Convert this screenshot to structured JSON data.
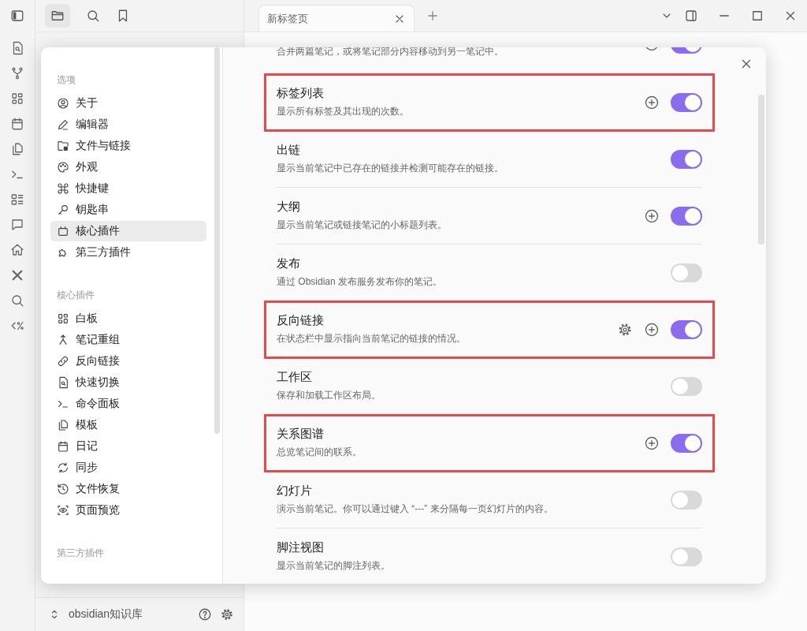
{
  "tab": {
    "title": "新标签页"
  },
  "settings": {
    "sidebar_sections": [
      {
        "header": "选项",
        "items": [
          {
            "label": "关于",
            "selected": false
          },
          {
            "label": "编辑器",
            "selected": false
          },
          {
            "label": "文件与链接",
            "selected": false
          },
          {
            "label": "外观",
            "selected": false
          },
          {
            "label": "快捷键",
            "selected": false
          },
          {
            "label": "钥匙串",
            "selected": false
          },
          {
            "label": "核心插件",
            "selected": true
          },
          {
            "label": "第三方插件",
            "selected": false
          }
        ]
      },
      {
        "header": "核心插件",
        "items": [
          {
            "label": "白板",
            "selected": false
          },
          {
            "label": "笔记重组",
            "selected": false
          },
          {
            "label": "反向链接",
            "selected": false
          },
          {
            "label": "快速切换",
            "selected": false
          },
          {
            "label": "命令面板",
            "selected": false
          },
          {
            "label": "模板",
            "selected": false
          },
          {
            "label": "日记",
            "selected": false
          },
          {
            "label": "同步",
            "selected": false
          },
          {
            "label": "文件恢复",
            "selected": false
          },
          {
            "label": "页面预览",
            "selected": false
          }
        ]
      },
      {
        "header": "第三方插件"
      }
    ],
    "plugins": [
      {
        "description": "合并两篇笔记，或将笔记部分内容移动到另一笔记中。",
        "on": true,
        "settings_button": false,
        "add_button": true,
        "highlighted": false
      },
      {
        "title": "标签列表",
        "description": "显示所有标签及其出现的次数。",
        "on": true,
        "settings_button": false,
        "add_button": true,
        "highlighted": true
      },
      {
        "title": "出链",
        "description": "显示当前笔记中已存在的链接并检测可能存在的链接。",
        "on": true,
        "settings_button": false,
        "add_button": false,
        "highlighted": false
      },
      {
        "title": "大纲",
        "description": "显示当前笔记或链接笔记的小标题列表。",
        "on": true,
        "settings_button": false,
        "add_button": true,
        "highlighted": false
      },
      {
        "title": "发布",
        "description": "通过 Obsidian 发布服务发布你的笔记。",
        "on": false,
        "settings_button": false,
        "add_button": false,
        "highlighted": false
      },
      {
        "title": "反向链接",
        "description": "在状态栏中显示指向当前笔记的链接的情况。",
        "on": true,
        "settings_button": true,
        "add_button": true,
        "highlighted": true
      },
      {
        "title": "工作区",
        "description": "保存和加载工作区布局。",
        "on": false,
        "settings_button": false,
        "add_button": false,
        "highlighted": false
      },
      {
        "title": "关系图谱",
        "description": "总览笔记间的联系。",
        "on": true,
        "settings_button": false,
        "add_button": true,
        "highlighted": true
      },
      {
        "title": "幻灯片",
        "description": "演示当前笔记。你可以通过键入 “---” 来分隔每一页幻灯片的内容。",
        "on": false,
        "settings_button": false,
        "add_button": false,
        "highlighted": false
      },
      {
        "title": "脚注视图",
        "description": "显示当前笔记的脚注列表。",
        "on": false,
        "settings_button": false,
        "add_button": false,
        "highlighted": false
      }
    ]
  },
  "vault": {
    "name": "obsidian知识库"
  }
}
